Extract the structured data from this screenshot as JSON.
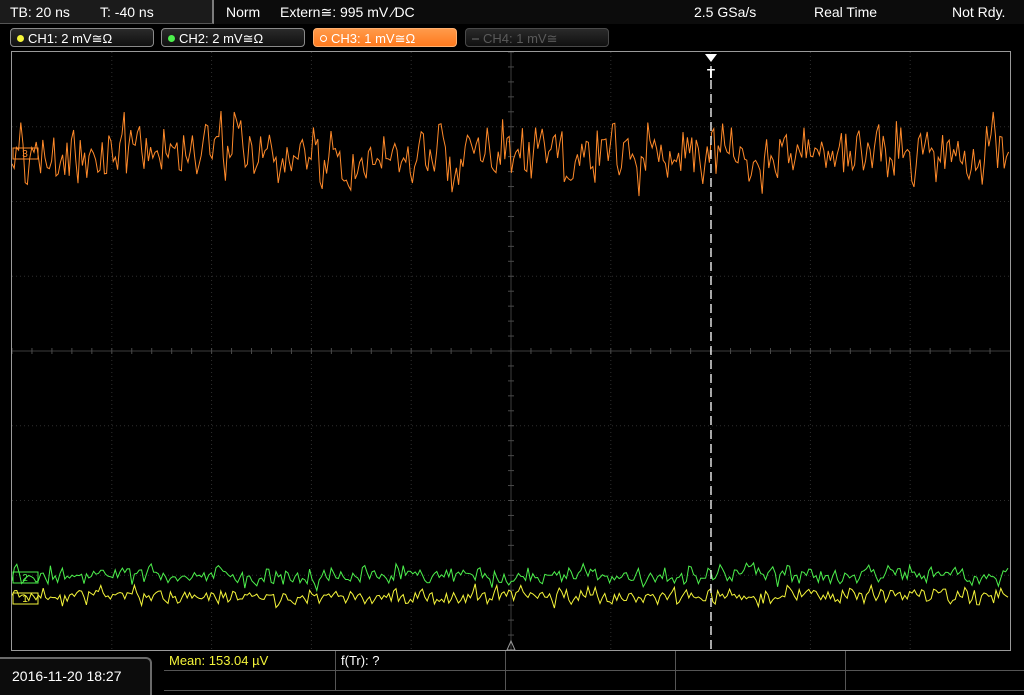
{
  "status": {
    "timebase": "TB: 20 ns",
    "trigger_offset": "T: -40 ns",
    "mode": "Norm",
    "trigger": "Extern≅: 995 mV ∕DC",
    "sample_rate": "2.5 GSa/s",
    "acquisition": "Real Time",
    "state": "Not Rdy."
  },
  "channels": [
    {
      "label": "CH1: 2 mV≅Ω",
      "color": "#f5f53a",
      "active": false,
      "enabled": true
    },
    {
      "label": "CH2: 2 mV≅Ω",
      "color": "#4cf04c",
      "active": false,
      "enabled": true
    },
    {
      "label": "CH3: 1 mV≅Ω",
      "color": "#ff8a2a",
      "active": true,
      "enabled": true
    },
    {
      "label": "CH4: 1 mV≅",
      "color": "#555555",
      "active": false,
      "enabled": false
    }
  ],
  "markers": {
    "ch3": "3",
    "ch2": "2",
    "ch1": "1",
    "trigger": "T"
  },
  "datetime": "2016-11-20 18:27",
  "measurements": {
    "mean": "Mean: 153.04 µV",
    "freq": "f(Tr): ?"
  },
  "colors": {
    "ch1": "#f5f53a",
    "ch2": "#4cf04c",
    "ch3": "#ff8a2a",
    "grid": "#3a3a3a"
  }
}
